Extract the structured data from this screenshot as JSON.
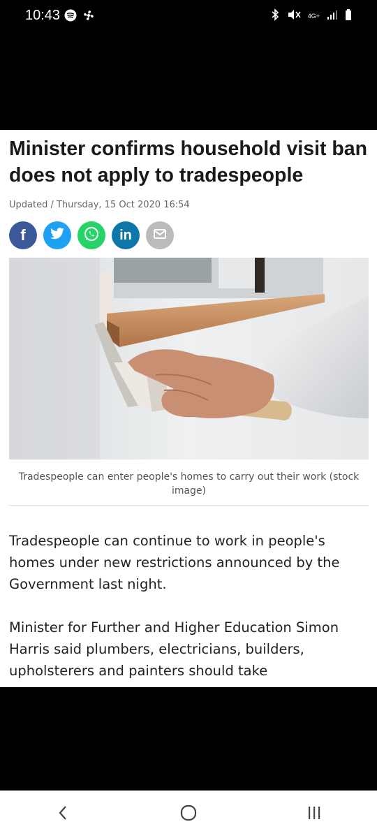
{
  "status_bar": {
    "time": "10:43",
    "left_icons": [
      "spotify-icon",
      "fan-icon"
    ],
    "right_icons": [
      "bluetooth-icon",
      "mute-icon",
      "4g-icon",
      "signal-icon",
      "battery-icon"
    ],
    "network": "4G+"
  },
  "article": {
    "headline": "Minister confirms household visit ban does not apply to tradespeople",
    "dateline": "Updated / Thursday, 15 Oct 2020 16:54",
    "share": [
      {
        "name": "facebook",
        "glyph": "f",
        "color": "#3b5998"
      },
      {
        "name": "twitter",
        "glyph": "t",
        "color": "#1da1f2"
      },
      {
        "name": "whatsapp",
        "glyph": "w",
        "color": "#25d366"
      },
      {
        "name": "linkedin",
        "glyph": "in",
        "color": "#0e76a8"
      },
      {
        "name": "email",
        "glyph": "✉",
        "color": "#bbbbbb"
      }
    ],
    "image_caption": "Tradespeople can enter people's homes to carry out their work (stock image)",
    "paragraph_1": "Tradespeople can continue to work in people's homes under new restrictions announced by the Government last night.",
    "paragraph_2": "Minister for Further and Higher Education Simon Harris said plumbers, electricians, builders, upholsterers and painters should take"
  },
  "nav": {
    "back_icon": "back-chevron-icon",
    "home_icon": "home-circle-icon",
    "recents_icon": "recents-bars-icon"
  }
}
